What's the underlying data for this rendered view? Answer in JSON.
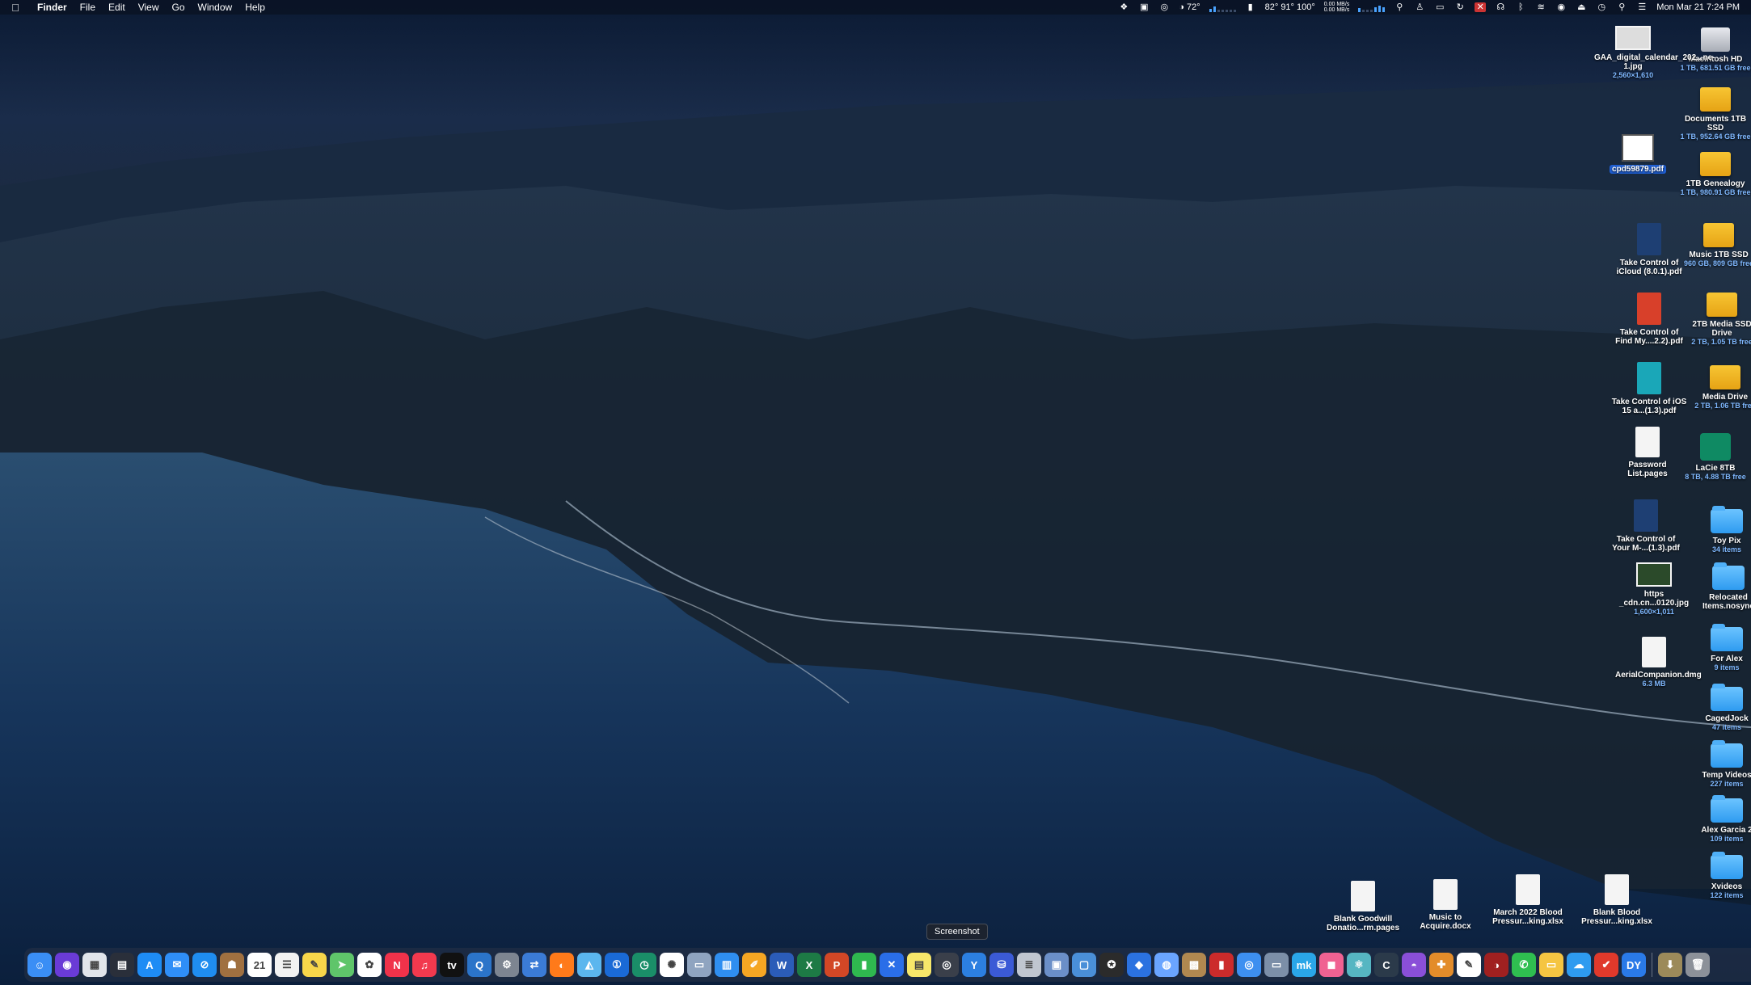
{
  "menubar": {
    "app_name": "Finder",
    "menus": [
      "File",
      "Edit",
      "View",
      "Go",
      "Window",
      "Help"
    ],
    "weather_temp": "72°",
    "temps": "82°  91° 100°",
    "net_up": "0.00 MB/s",
    "net_down": "0.00 MB/s",
    "clock": "Mon Mar 21  7:24 PM"
  },
  "desktop": {
    "right_column": [
      {
        "name": "Macintosh HD",
        "sub": "1 TB, 681.51 GB free",
        "type": "hd"
      },
      {
        "name": "Documents 1TB SSD",
        "sub": "1 TB, 952.64 GB free",
        "type": "drive"
      },
      {
        "name": "1TB Genealogy",
        "sub": "1 TB, 980.91 GB free",
        "type": "drive"
      },
      {
        "name": "Music 1TB SSD",
        "sub": "960 GB, 809 GB free",
        "type": "drive"
      },
      {
        "name": "2TB Media SSD Drive",
        "sub": "2 TB, 1.05 TB free",
        "type": "drive"
      },
      {
        "name": "Media Drive",
        "sub": "2 TB, 1.06 TB free",
        "type": "drive"
      },
      {
        "name": "LaCie 8TB",
        "sub": "8 TB, 4.88 TB free",
        "type": "timemachine"
      },
      {
        "name": "Toy Pix",
        "sub": "34 items",
        "type": "folder"
      },
      {
        "name": "Relocated Items.nosync",
        "sub": "",
        "type": "folder"
      },
      {
        "name": "For Alex",
        "sub": "9 items",
        "type": "folder"
      },
      {
        "name": "CagedJock",
        "sub": "47 items",
        "type": "folder"
      },
      {
        "name": "Temp Videos",
        "sub": "227 items",
        "type": "folder"
      },
      {
        "name": "Alex Garcia 2",
        "sub": "109 items",
        "type": "folder"
      },
      {
        "name": "Xvideos",
        "sub": "122 items",
        "type": "folder"
      }
    ],
    "second_column": [
      {
        "name": "GAA_digital_calendar_202...ne-1.jpg",
        "sub": "2,560×1,610",
        "type": "image"
      },
      {
        "name": "cpd59879.pdf",
        "sub": "",
        "type": "pdf-white",
        "selected": true
      },
      {
        "name": "Take Control of iCloud (8.0.1).pdf",
        "sub": "",
        "type": "pdf-blue"
      },
      {
        "name": "Take Control of Find My....2.2).pdf",
        "sub": "",
        "type": "pdf-red"
      },
      {
        "name": "Take Control of iOS 15 a...(1.3).pdf",
        "sub": "",
        "type": "pdf-teal"
      },
      {
        "name": "Password List.pages",
        "sub": "",
        "type": "doc"
      },
      {
        "name": "Take Control of Your M-...(1.3).pdf",
        "sub": "",
        "type": "pdf-blue"
      },
      {
        "name": "https _cdn.cn...0120.jpg",
        "sub": "1,600×1,011",
        "type": "image-dark"
      },
      {
        "name": "AerialCompanion.dmg",
        "sub": "6.3 MB",
        "type": "doc"
      }
    ],
    "bottom_row": [
      {
        "name": "Blank Goodwill Donatio...rm.pages",
        "sub": "",
        "type": "doc"
      },
      {
        "name": "Music to Acquire.docx",
        "sub": "",
        "type": "doc"
      },
      {
        "name": "March 2022 Blood Pressur...king.xlsx",
        "sub": "",
        "type": "doc"
      },
      {
        "name": "Blank Blood Pressur...king.xlsx",
        "sub": "",
        "type": "doc"
      }
    ]
  },
  "tooltip": "Screenshot",
  "dock": {
    "items": [
      {
        "name": "finder-icon",
        "color": "#3a8ef5",
        "glyph": "☺"
      },
      {
        "name": "siri-icon",
        "color": "#6a3bd6",
        "glyph": "◉"
      },
      {
        "name": "launchpad-icon",
        "color": "#e0e4ea",
        "glyph": "▦"
      },
      {
        "name": "mission-control-icon",
        "color": "#2a2f3a",
        "glyph": "▤"
      },
      {
        "name": "app-store-icon",
        "color": "#1e8cf5",
        "glyph": "A"
      },
      {
        "name": "mail-icon",
        "color": "#2f8ef7",
        "glyph": "✉"
      },
      {
        "name": "safari-icon",
        "color": "#1f8df0",
        "glyph": "⊘"
      },
      {
        "name": "notes-app-icon",
        "color": "#a07040",
        "glyph": "☗"
      },
      {
        "name": "calendar-icon",
        "color": "#ffffff",
        "glyph": "21"
      },
      {
        "name": "reminders-icon",
        "color": "#f2f2f2",
        "glyph": "☰"
      },
      {
        "name": "notes-icon",
        "color": "#f7d64a",
        "glyph": "✎"
      },
      {
        "name": "maps-icon",
        "color": "#5fc56a",
        "glyph": "➤"
      },
      {
        "name": "photos-icon",
        "color": "#ffffff",
        "glyph": "✿"
      },
      {
        "name": "news-icon",
        "color": "#f0324a",
        "glyph": "N"
      },
      {
        "name": "music-icon",
        "color": "#f2394e",
        "glyph": "♫"
      },
      {
        "name": "tv-icon",
        "color": "#111111",
        "glyph": "tv"
      },
      {
        "name": "quicktime-icon",
        "color": "#2b74c9",
        "glyph": "Q"
      },
      {
        "name": "system-preferences-icon",
        "color": "#7d8591",
        "glyph": "⚙"
      },
      {
        "name": "migration-icon",
        "color": "#3b7bd6",
        "glyph": "⇄"
      },
      {
        "name": "firefox-icon",
        "color": "#ff7a1a",
        "glyph": "◐"
      },
      {
        "name": "preview-icon",
        "color": "#5bb6ee",
        "glyph": "◭"
      },
      {
        "name": "one-password-icon",
        "color": "#1a6ad6",
        "glyph": "①"
      },
      {
        "name": "time-machine-icon",
        "color": "#1a8e68",
        "glyph": "◷"
      },
      {
        "name": "pinwheel-icon",
        "color": "#ffffff",
        "glyph": "✺"
      },
      {
        "name": "scanner-icon",
        "color": "#8fa4c0",
        "glyph": "▭"
      },
      {
        "name": "keynote-icon",
        "color": "#2f8ef0",
        "glyph": "▥"
      },
      {
        "name": "pages-icon",
        "color": "#f5a623",
        "glyph": "✐"
      },
      {
        "name": "word-icon",
        "color": "#2b5cb8",
        "glyph": "W"
      },
      {
        "name": "excel-icon",
        "color": "#1d7a45",
        "glyph": "X"
      },
      {
        "name": "powerpoint-icon",
        "color": "#d24726",
        "glyph": "P"
      },
      {
        "name": "numbers-icon",
        "color": "#2fb84f",
        "glyph": "▮"
      },
      {
        "name": "xcode-tools-icon",
        "color": "#2a6ee8",
        "glyph": "✕"
      },
      {
        "name": "stickies-icon",
        "color": "#f7e76a",
        "glyph": "▤"
      },
      {
        "name": "screenshot-icon",
        "color": "#3a3f4a",
        "glyph": "◎"
      },
      {
        "name": "yoink-icon",
        "color": "#2c7fe0",
        "glyph": "Y"
      },
      {
        "name": "disk-utility-icon",
        "color": "#3b5ad6",
        "glyph": "⛁"
      },
      {
        "name": "stack-icon",
        "color": "#c0c6d0",
        "glyph": "≣"
      },
      {
        "name": "archive-icon",
        "color": "#6b8fc8",
        "glyph": "▣"
      },
      {
        "name": "finder-window-icon",
        "color": "#4a8fd8",
        "glyph": "▢"
      },
      {
        "name": "cursor-icon",
        "color": "#2b2b2b",
        "glyph": "✪"
      },
      {
        "name": "layers-icon",
        "color": "#2b72e0",
        "glyph": "◆"
      },
      {
        "name": "color-picker-icon",
        "color": "#6aa5ff",
        "glyph": "◍"
      },
      {
        "name": "archive-utility-icon",
        "color": "#b08850",
        "glyph": "▩"
      },
      {
        "name": "usb-icon",
        "color": "#cc2b2b",
        "glyph": "▮"
      },
      {
        "name": "network-icon",
        "color": "#3d8ff0",
        "glyph": "◎"
      },
      {
        "name": "screens-icon",
        "color": "#7c8fa8",
        "glyph": "▭"
      },
      {
        "name": "mk-icon",
        "color": "#2aa6e8",
        "glyph": "mk"
      },
      {
        "name": "cleanmymac-icon",
        "color": "#f06292",
        "glyph": "◼"
      },
      {
        "name": "atom-icon",
        "color": "#56b6c2",
        "glyph": "⚛"
      },
      {
        "name": "arc-icon",
        "color": "#2b3a4a",
        "glyph": "C"
      },
      {
        "name": "nova-icon",
        "color": "#8a4fd8",
        "glyph": "◓"
      },
      {
        "name": "bartender-icon",
        "color": "#e38c2a",
        "glyph": "✚"
      },
      {
        "name": "inkscape-icon",
        "color": "#ffffff",
        "glyph": "✎"
      },
      {
        "name": "rogue-amoeba-icon",
        "color": "#a02020",
        "glyph": "◑"
      },
      {
        "name": "whatsapp-icon",
        "color": "#2fbf50",
        "glyph": "✆"
      },
      {
        "name": "folder-app-icon",
        "color": "#f5c542",
        "glyph": "▭"
      },
      {
        "name": "cloud-weather-icon",
        "color": "#2e9bf0",
        "glyph": "☁"
      },
      {
        "name": "todoist-icon",
        "color": "#e0392b",
        "glyph": "✔"
      },
      {
        "name": "dymo-icon",
        "color": "#2a7ae8",
        "glyph": "DY"
      },
      {
        "name": "downloads-icon",
        "color": "#9c8a5a",
        "glyph": "⬇"
      },
      {
        "name": "trash-icon",
        "color": "#8c9199",
        "glyph": "🗑"
      }
    ],
    "separator_index": 59,
    "active_indices": [
      0,
      33,
      59
    ]
  }
}
